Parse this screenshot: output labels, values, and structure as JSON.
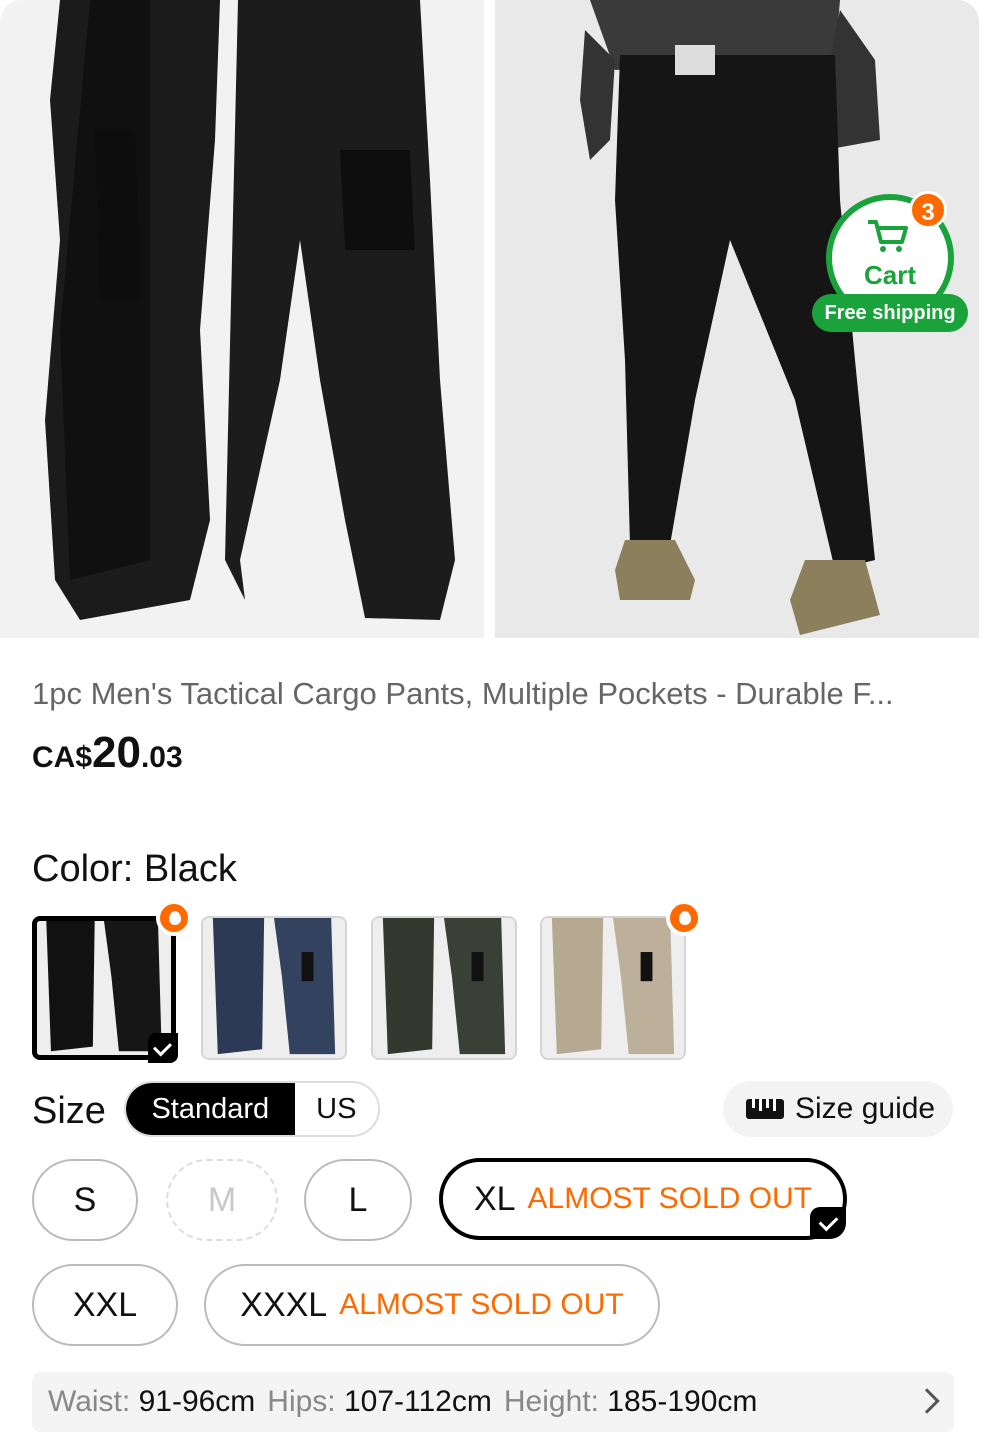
{
  "product": {
    "title": "1pc Men's Tactical Cargo Pants, Multiple Pockets - Durable F...",
    "price": {
      "currency": "CA$",
      "integer": "20",
      "decimal": ".03"
    }
  },
  "cart": {
    "label": "Cart",
    "count": "3",
    "shipping_badge": "Free shipping",
    "accent": "#1aa33b",
    "badge_color": "#ff6a00"
  },
  "color": {
    "label": "Color: ",
    "selected": "Black",
    "swatches": [
      "black",
      "navy",
      "olive",
      "khaki"
    ]
  },
  "size": {
    "label": "Size",
    "tabs": [
      "Standard",
      "US"
    ],
    "guide_label": "Size guide",
    "options": [
      {
        "size": "S"
      },
      {
        "size": "M"
      },
      {
        "size": "L"
      },
      {
        "size": "XL",
        "note": "ALMOST SOLD OUT"
      },
      {
        "size": "XXL"
      },
      {
        "size": "XXXL",
        "note": "ALMOST SOLD OUT"
      }
    ]
  },
  "measurements": {
    "waist_label": "Waist:",
    "waist": "91-96cm",
    "hips_label": "Hips:",
    "hips": "107-112cm",
    "height_label": "Height:",
    "height": "185-190cm"
  },
  "icons": [
    "cart-icon",
    "hot-icon",
    "check-icon",
    "ruler-icon",
    "chevron-right-icon"
  ],
  "warning_color": "#ff6a00"
}
